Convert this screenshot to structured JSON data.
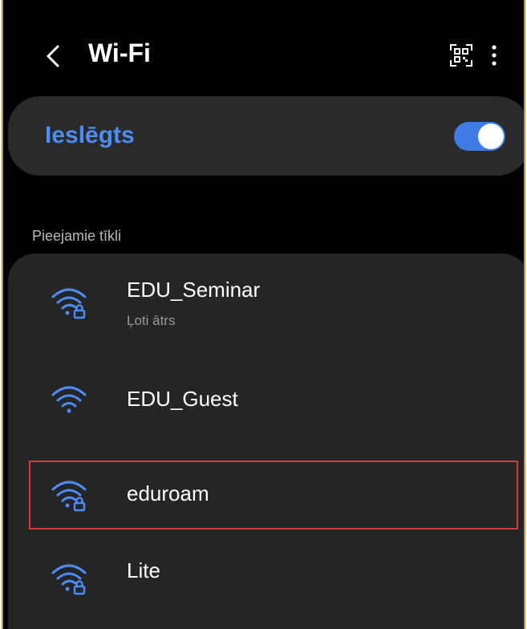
{
  "header": {
    "title": "Wi-Fi"
  },
  "toggle": {
    "label": "Ieslēgts",
    "state": "on",
    "accent": "#4d8cf5"
  },
  "section": {
    "label": "Pieejamie tīkli"
  },
  "networks": [
    {
      "name": "EDU_Seminar",
      "subtitle": "Ļoti ātrs",
      "secured": true,
      "icon": "wifi-lock-icon"
    },
    {
      "name": "EDU_Guest",
      "subtitle": "",
      "secured": false,
      "icon": "wifi-icon"
    },
    {
      "name": "eduroam",
      "subtitle": "",
      "secured": true,
      "icon": "wifi-lock-icon",
      "highlighted": true
    },
    {
      "name": "Lite",
      "subtitle": "",
      "secured": true,
      "icon": "wifi-lock-icon"
    }
  ],
  "colors": {
    "background": "#000000",
    "card": "#252525",
    "wifi_icon": "#4d8cf5",
    "highlight": "#d43a3a"
  }
}
